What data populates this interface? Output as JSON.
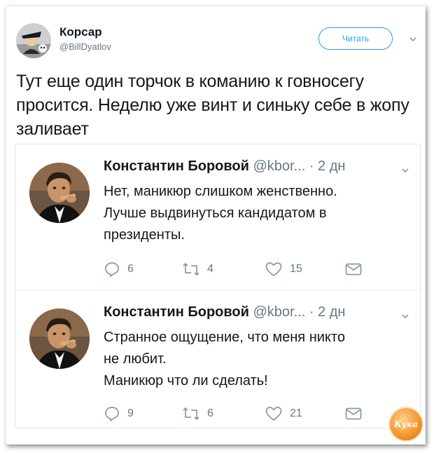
{
  "tweet": {
    "author_name": "Корсар",
    "author_handle": "@BillDyatlov",
    "follow_label": "Читать",
    "text": "Тут еще один торчок в команию к говносегу просится. Неделю уже винт и синьку себе в жопу заливает"
  },
  "replies": [
    {
      "name": "Константин Боровой",
      "handle": "@kbor...",
      "time": "· 2 дн",
      "text_lines": [
        "Нет, маникюр слишком женственно.",
        "Лучше выдвинуться кандидатом в",
        "президенты."
      ],
      "reply_count": "6",
      "retweet_count": "4",
      "like_count": "15"
    },
    {
      "name": "Константин Боровой",
      "handle": "@kbor...",
      "time": "· 2 дн",
      "text_lines": [
        "Странное ощущение, что меня никто",
        "не любит.",
        "Маникюр что ли сделать!"
      ],
      "reply_count": "9",
      "retweet_count": "6",
      "like_count": "21"
    }
  ],
  "icons": {
    "reply": "reply-icon",
    "retweet": "retweet-icon",
    "like": "heart-icon",
    "dm": "envelope-icon",
    "more": "chevron-down-icon"
  },
  "colors": {
    "accent": "#1da1f2",
    "muted": "#657786",
    "text": "#14171a",
    "border": "#e1e8ed"
  },
  "watermark": "Кука"
}
